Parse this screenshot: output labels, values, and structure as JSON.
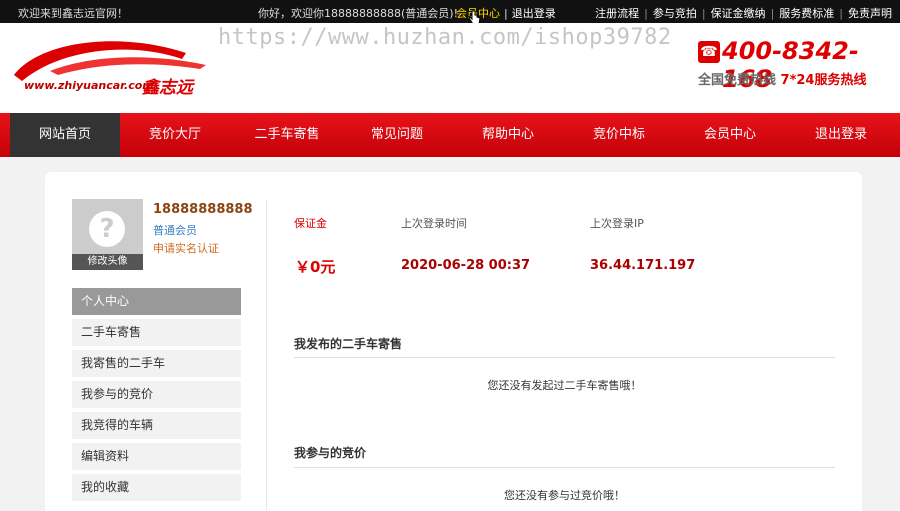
{
  "topbar": {
    "welcome": "欢迎来到鑫志远官网！",
    "greeting": "你好，欢迎你18888888888(普通会员)!",
    "member_center": "会员中心",
    "logout": "退出登录",
    "links": [
      "注册流程",
      "参与竞拍",
      "保证金缴纳",
      "服务费标准",
      "免责声明"
    ]
  },
  "header": {
    "logo_url_text": "www.zhiyuancar.com",
    "logo_cn": "鑫志远",
    "watermark": "https://www.huzhan.com/ishop39782",
    "hotline": "400-8342-168",
    "hotline_desc_a": "全国免费热线",
    "hotline_desc_b": "7*24服务热线"
  },
  "nav": [
    "网站首页",
    "竞价大厅",
    "二手车寄售",
    "常见问题",
    "帮助中心",
    "竞价中标",
    "会员中心",
    "退出登录"
  ],
  "profile": {
    "username": "18888888888",
    "level": "普通会员",
    "verify": "申请实名认证",
    "edit_avatar": "修改头像"
  },
  "menu": [
    "个人中心",
    "二手车寄售",
    "我寄售的二手车",
    "我参与的竞价",
    "我竞得的车辆",
    "编辑资料",
    "我的收藏"
  ],
  "stats": {
    "deposit_label": "保证金",
    "deposit_value": "￥0元",
    "last_login_time_label": "上次登录时间",
    "last_login_time": "2020-06-28 00:37",
    "last_login_ip_label": "上次登录IP",
    "last_login_ip": "36.44.171.197"
  },
  "sections": {
    "consign_title": "我发布的二手车寄售",
    "consign_empty": "您还没有发起过二手车寄售哦！",
    "bid_title": "我参与的竞价",
    "bid_empty": "您还没有参与过竞价哦！"
  },
  "colors": {
    "brand_red": "#d00",
    "nav_active": "#333",
    "topbar": "#111"
  }
}
